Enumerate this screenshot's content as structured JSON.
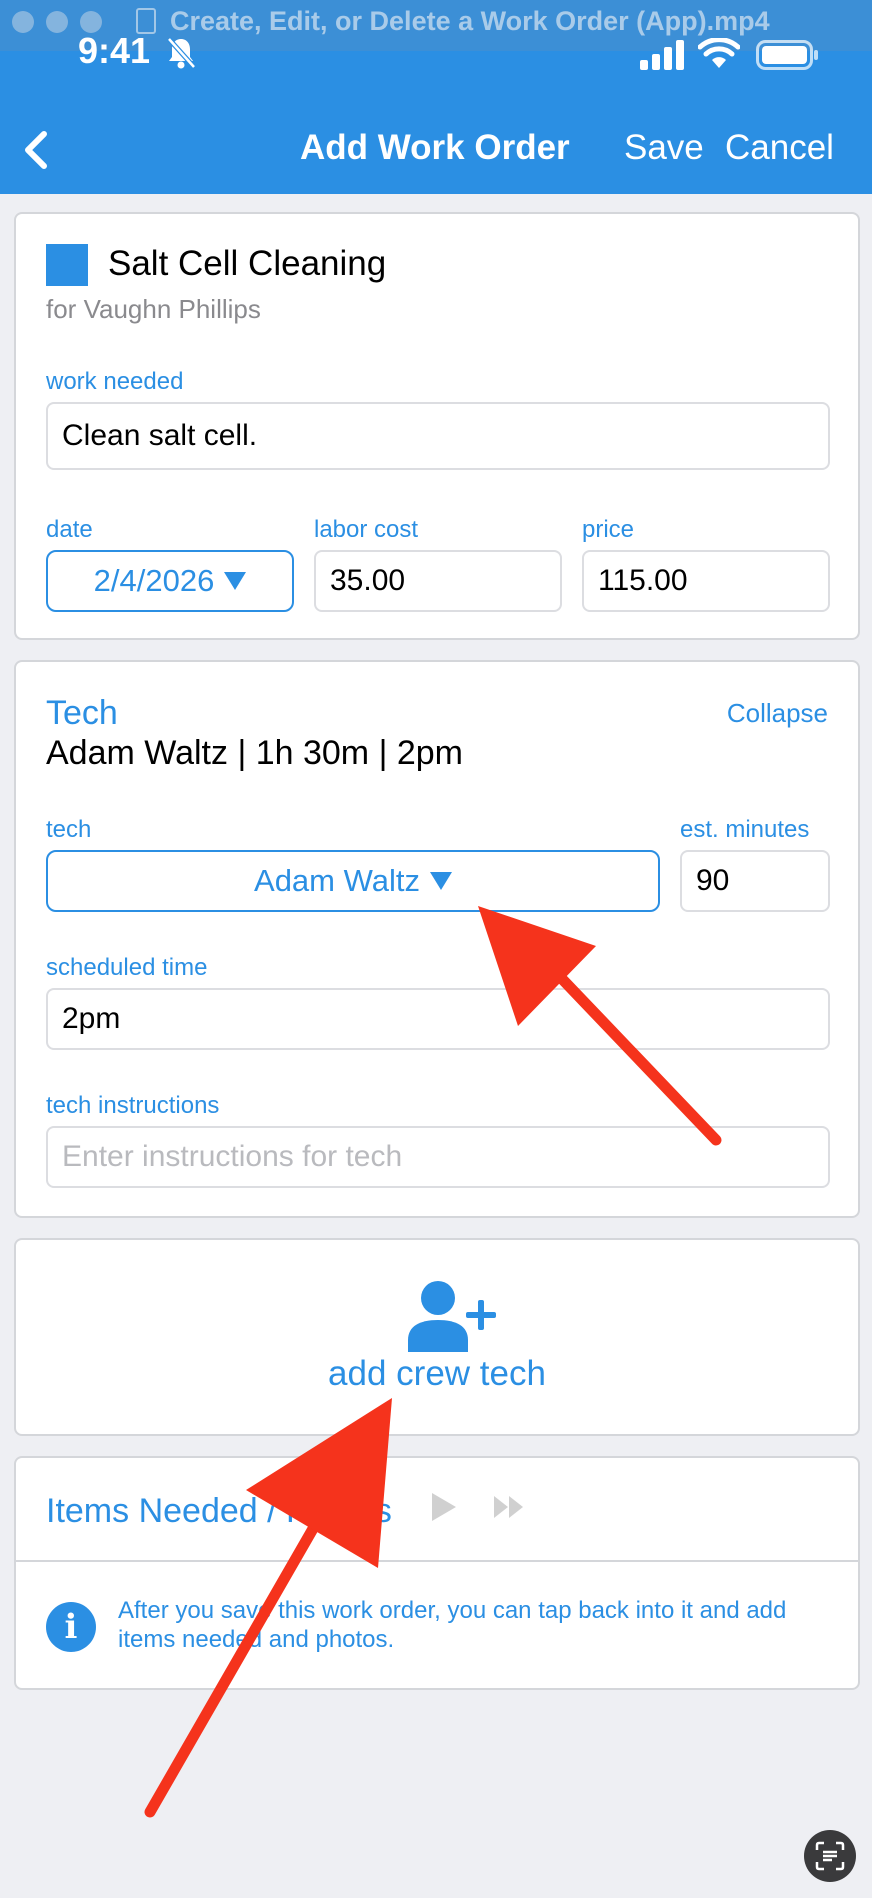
{
  "window": {
    "title": "Create, Edit, or Delete a Work Order (App).mp4"
  },
  "status_bar": {
    "time": "9:41"
  },
  "nav": {
    "title": "Add Work Order",
    "save_label": "Save",
    "cancel_label": "Cancel"
  },
  "work_order": {
    "title": "Salt Cell Cleaning",
    "subtitle": "for Vaughn Phillips",
    "color": "#2b8fe3",
    "work_needed_label": "work needed",
    "work_needed_value": "Clean salt cell.",
    "date_label": "date",
    "date_value": "2/4/2026",
    "labor_cost_label": "labor cost",
    "labor_cost_value": "35.00",
    "price_label": "price",
    "price_value": "115.00"
  },
  "tech": {
    "heading": "Tech",
    "collapse_label": "Collapse",
    "summary": "Adam Waltz | 1h 30m | 2pm",
    "tech_label": "tech",
    "tech_value": "Adam Waltz",
    "est_minutes_label": "est. minutes",
    "est_minutes_value": "90",
    "scheduled_time_label": "scheduled time",
    "scheduled_time_value": "2pm",
    "instructions_label": "tech instructions",
    "instructions_placeholder": "Enter instructions for tech"
  },
  "crew": {
    "add_label": "add crew tech"
  },
  "items": {
    "heading": "Items Needed / Photos",
    "info_text": "After you save this work order, you can tap back into it and add items needed and photos."
  },
  "colors": {
    "accent": "#2b8fe3",
    "annotation_arrow": "#f5331c",
    "background": "#eeeff3"
  }
}
